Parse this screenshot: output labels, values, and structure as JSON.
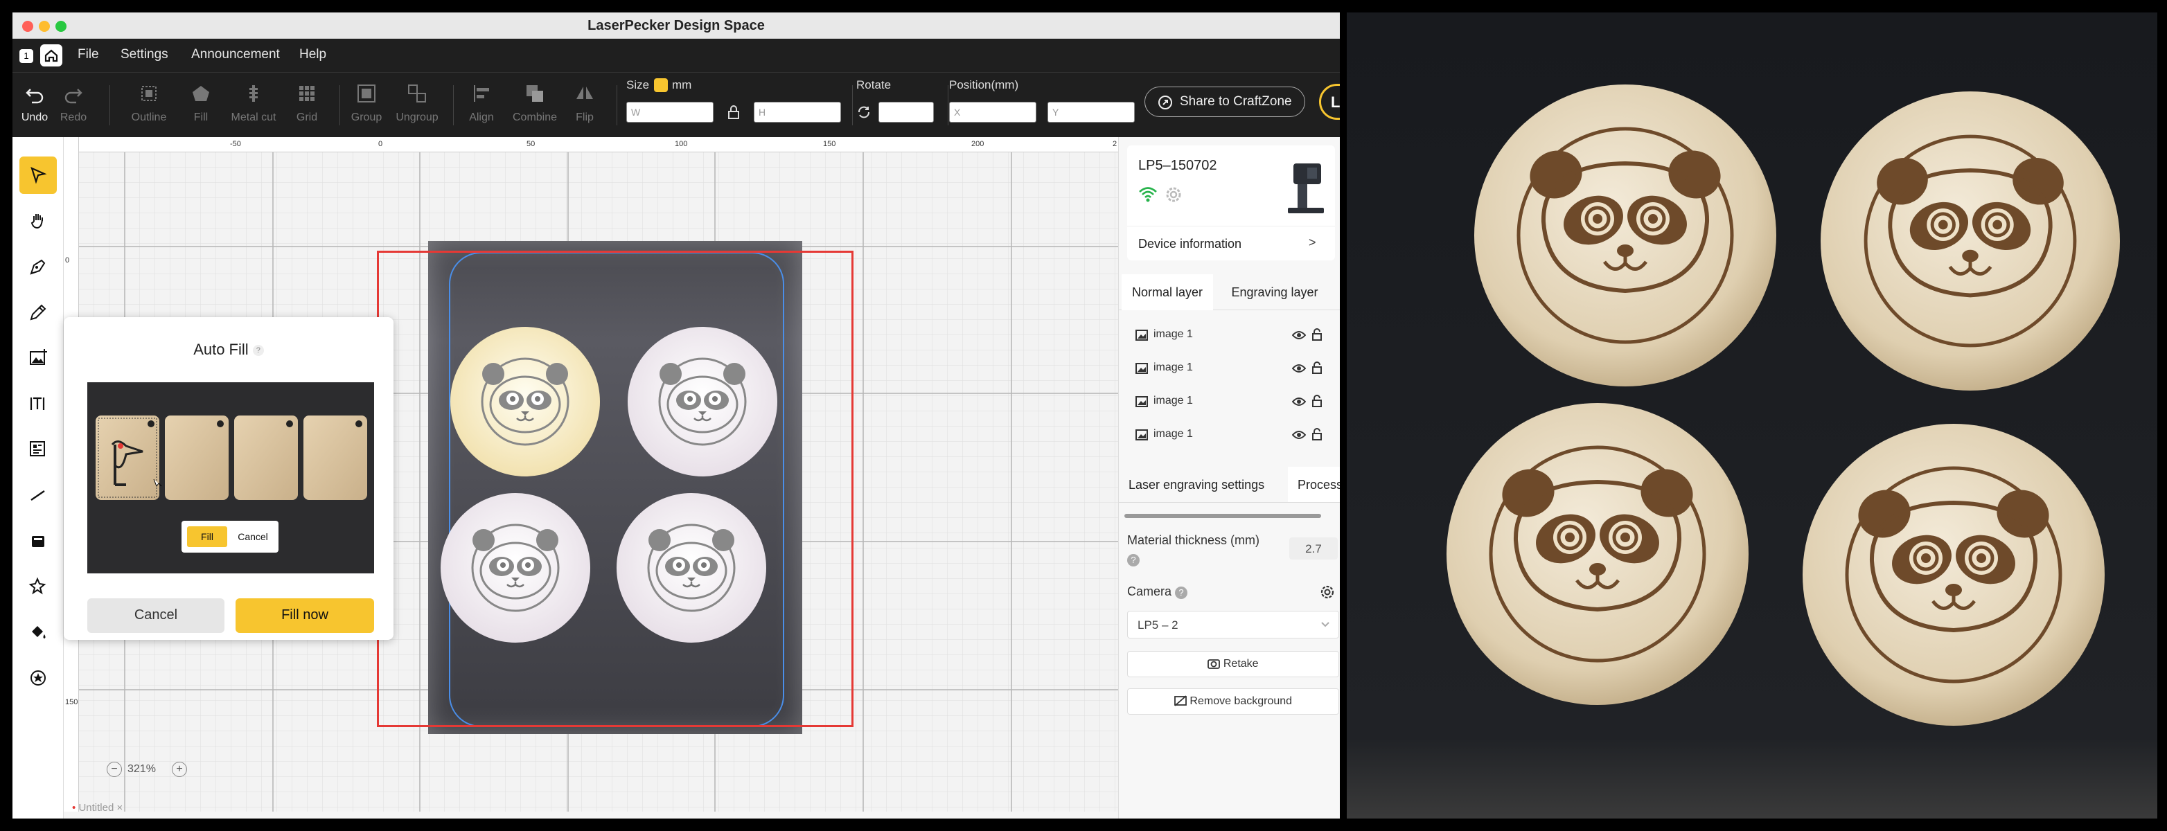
{
  "window": {
    "title": "LaserPecker Design Space",
    "badge": "1"
  },
  "menu": {
    "file": "File",
    "settings": "Settings",
    "announcement": "Announcement",
    "help": "Help"
  },
  "toolbar": {
    "undo": "Undo",
    "redo": "Redo",
    "outline": "Outline",
    "fill": "Fill",
    "metal_cut": "Metal cut",
    "grid": "Grid",
    "group": "Group",
    "ungroup": "Ungroup",
    "align": "Align",
    "combine": "Combine",
    "flip": "Flip",
    "size_label": "Size",
    "unit": "mm",
    "w_placeholder": "W",
    "h_placeholder": "H",
    "rotate_label": "Rotate",
    "position_label": "Position(mm)",
    "x_placeholder": "X",
    "y_placeholder": "Y",
    "share": "Share to CraftZone",
    "laser_button_partial": "La"
  },
  "rulers": {
    "top": [
      "-50",
      "0",
      "50",
      "100",
      "150",
      "200",
      "2"
    ],
    "left": [
      "0",
      "150"
    ]
  },
  "zoom": {
    "value": "321%",
    "minus": "−",
    "plus": "+"
  },
  "document_tab": {
    "name": "Untitled",
    "close": "×"
  },
  "auto_fill": {
    "title": "Auto Fill",
    "help": "?",
    "preview_fill": "Fill",
    "preview_cancel": "Cancel",
    "cancel": "Cancel",
    "fill_now": "Fill now"
  },
  "device": {
    "name": "LP5–150702",
    "info": "Device information",
    "chevron": ">"
  },
  "layers": {
    "tabs": [
      "Normal layer",
      "Engraving layer"
    ],
    "items": [
      "image 1",
      "image 1",
      "image 1",
      "image 1"
    ]
  },
  "settings": {
    "tabs": [
      "Laser engraving settings",
      "Process"
    ],
    "material_label": "Material thickness (mm)",
    "material_value": "2.7",
    "camera_label": "Camera",
    "camera_value": "LP5 – 2",
    "retake": "Retake",
    "remove_background": "Remove background"
  },
  "colors": {
    "accent": "#f7c52f",
    "selection": "#e53935",
    "dark": "#1f1f1f"
  }
}
